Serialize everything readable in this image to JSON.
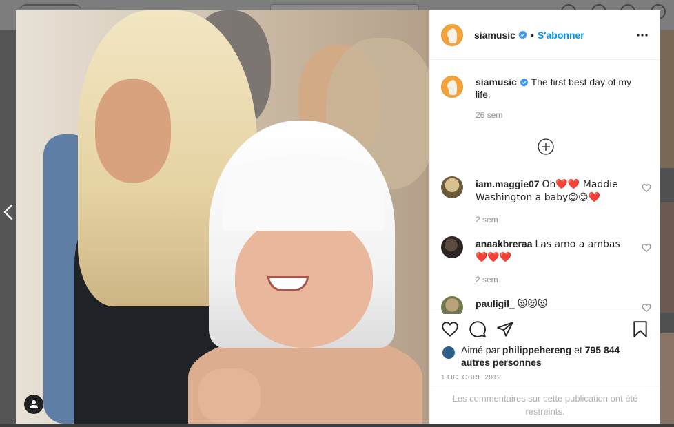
{
  "post": {
    "author": "siamusic",
    "follow_label": "S'abonner",
    "separator": "•",
    "caption": "The first best day of my life.",
    "caption_time": "26 sem",
    "accent_color": "#0095f6"
  },
  "comments": [
    {
      "user": "iam.maggie07",
      "text": "Oh❤️❤️ Maddie Washington a baby😊😊❤️",
      "time": "2 sem"
    },
    {
      "user": "anaakbreraa",
      "text": "Las amo a ambas❤️❤️❤️",
      "time": "2 sem"
    },
    {
      "user": "pauligil_",
      "text": "😻😻😻",
      "time": ""
    }
  ],
  "likes": {
    "prefix": "Aimé par",
    "first_user": "philippehereng",
    "connector": "et",
    "others": "795 844 autres personnes"
  },
  "date": "1 OCTOBRE 2019",
  "restricted_notice": "Les commentaires sur cette publication ont été restreints.",
  "icons": {
    "more": "more-horizontal-icon",
    "load_more": "plus-circle-icon",
    "like": "heart-icon",
    "comment": "comment-bubble-icon",
    "share": "paper-plane-icon",
    "save": "bookmark-icon",
    "prev": "chevron-left-icon",
    "tags": "user-tag-icon"
  }
}
